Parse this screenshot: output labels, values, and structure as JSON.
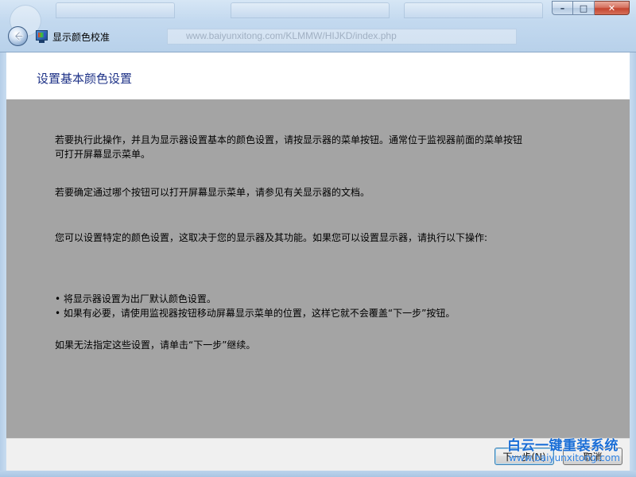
{
  "window": {
    "title": "显示颜色校准",
    "controls": {
      "minimize": "–",
      "maximize": "□",
      "close": "✕"
    },
    "background_url": "www.baiyunxitong.com/KLMMW/HIJKD/index.php"
  },
  "header": {
    "title": "设置基本颜色设置"
  },
  "content": {
    "paragraph1_line1": "若要执行此操作，并且为显示器设置基本的颜色设置，请按显示器的菜单按钮。通常位于监视器前面的菜单按钮",
    "paragraph1_line2": "可打开屏幕显示菜单。",
    "paragraph2": "若要确定通过哪个按钮可以打开屏幕显示菜单，请参见有关显示器的文档。",
    "paragraph3": "您可以设置特定的颜色设置，这取决于您的显示器及其功能。如果您可以设置显示器，请执行以下操作:",
    "bullets": [
      "• 将显示器设置为出厂默认颜色设置。",
      "• 如果有必要，请使用监视器按钮移动屏幕显示菜单的位置，这样它就不会覆盖“下一步”按钮。"
    ],
    "paragraph4": "如果无法指定这些设置，请单击“下一步”继续。"
  },
  "footer": {
    "next_label": "下一步(N)",
    "cancel_label": "取消"
  },
  "watermark": {
    "title": "白云一键重装系统",
    "url": "www.baiyunxitong.com"
  },
  "colors": {
    "header_title": "#1e3287",
    "content_bg": "#a4a4a4",
    "watermark": "#1a6ed6"
  },
  "icons": {
    "back": "back-arrow-icon",
    "app": "display-monitor-icon"
  }
}
